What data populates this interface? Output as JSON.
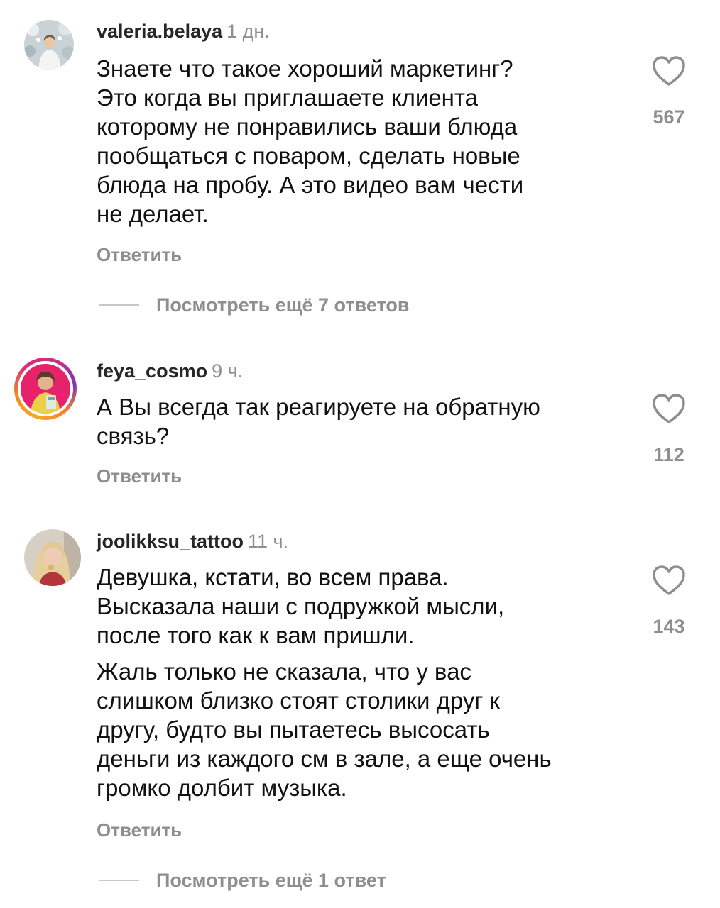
{
  "comments": [
    {
      "username": "valeria.belaya",
      "time": "1 дн.",
      "paragraphs": [
        "Знаете что такое хороший маркетинг?\nЭто когда вы приглашаете клиента\nкоторому не понравились ваши блюда\nпообщаться с поваром, сделать новые\nблюда на пробу. А это видео вам чести\nне делает."
      ],
      "likes": "567",
      "reply_label": "Ответить",
      "more_replies": "Посмотреть ещё 7 ответов"
    },
    {
      "username": "feya_cosmo",
      "time": "9 ч.",
      "paragraphs": [
        "А Вы всегда так реагируете на обратную\nсвязь?"
      ],
      "likes": "112",
      "reply_label": "Ответить"
    },
    {
      "username": "joolikksu_tattoo",
      "time": "11 ч.",
      "paragraphs": [
        "Девушка, кстати, во всем права.\nВысказала наши с подружкой мысли,\nпосле того как к вам пришли.",
        "Жаль только не сказала, что у вас\nслишком близко стоят столики друг к\nдругу, будто вы пытаетесь высосать\nденьги из каждого см в зале, а еще очень\nгромко долбит музыка."
      ],
      "likes": "143",
      "reply_label": "Ответить",
      "more_replies": "Посмотреть ещё 1 ответ"
    }
  ],
  "colors": {
    "text": "#111111",
    "muted": "#8e8e8e",
    "divider": "#c7c7c7",
    "story_ring": [
      "#f9a825",
      "#dd2a7b",
      "#8134af"
    ]
  },
  "icons": {
    "like": "heart-outline-icon"
  }
}
